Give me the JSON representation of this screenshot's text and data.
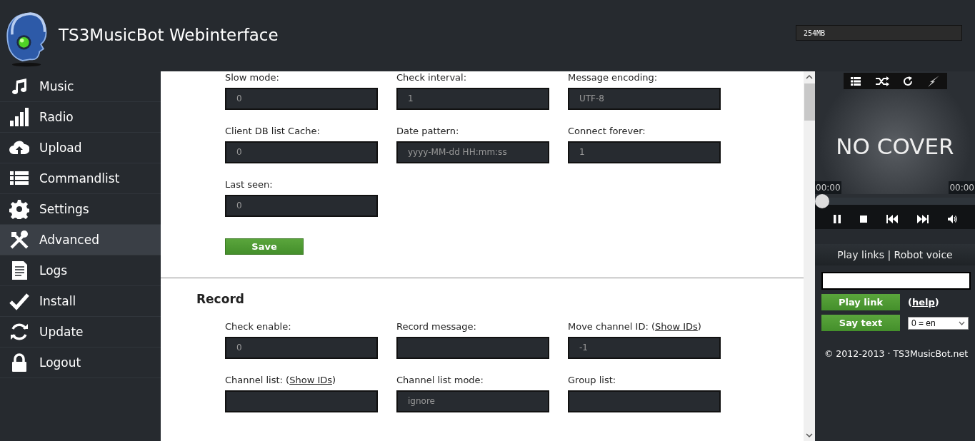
{
  "header": {
    "title": "TS3MusicBot Webinterface",
    "memory": "254MB"
  },
  "sidebar": {
    "items": [
      {
        "label": "Music",
        "selected": false
      },
      {
        "label": "Radio",
        "selected": false
      },
      {
        "label": "Upload",
        "selected": false
      },
      {
        "label": "Commandlist",
        "selected": false
      },
      {
        "label": "Settings",
        "selected": false
      },
      {
        "label": "Advanced",
        "selected": true
      },
      {
        "label": "Logs",
        "selected": false
      },
      {
        "label": "Install",
        "selected": false
      },
      {
        "label": "Update",
        "selected": false
      },
      {
        "label": "Logout",
        "selected": false
      }
    ]
  },
  "sections": [
    {
      "fields": [
        {
          "label": "Slow mode:",
          "value": "0"
        },
        {
          "label": "Check interval:",
          "value": "1"
        },
        {
          "label": "Message encoding:",
          "value": "UTF-8"
        },
        {
          "label": "Client DB list Cache:",
          "value": "0"
        },
        {
          "label": "Date pattern:",
          "value": "yyyy-MM-dd HH:mm:ss"
        },
        {
          "label": "Connect forever:",
          "value": "1"
        },
        {
          "label": "Last seen:",
          "value": "0"
        }
      ],
      "button": "Save"
    },
    {
      "title": "Record",
      "fields": [
        {
          "label": "Check enable:",
          "value": "0"
        },
        {
          "label": "Record message:"
        },
        {
          "label": "Move channel ID: (",
          "link": "Show IDs",
          "label_end": ")",
          "value": "-1"
        },
        {
          "label": "Channel list: (",
          "link": "Show IDs",
          "label_end": ")"
        },
        {
          "label": "Channel list mode:",
          "value": "ignore"
        },
        {
          "label": "Group list:"
        }
      ]
    }
  ],
  "player": {
    "cover_text": "NO COVER",
    "time_elapsed": "00:00",
    "time_total": "00:00",
    "progress": {
      "level": 0
    }
  },
  "tools": {
    "tabs_text": "Play links | Robot voice",
    "play_button": "Play link",
    "help_open": "(",
    "help_link": "help",
    "help_close": ")",
    "say_button": "Say text",
    "voice": "0 = en",
    "footer": "© 2012-2013 · TS3MusicBot.net"
  }
}
